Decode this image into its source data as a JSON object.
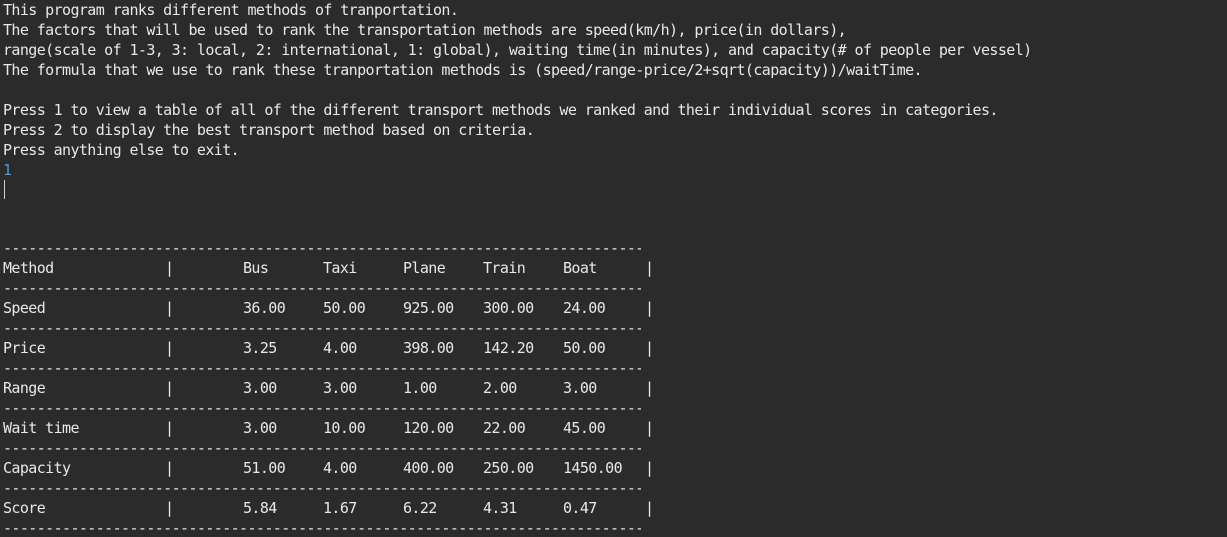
{
  "intro": {
    "line1": "This program ranks different methods of tranportation.",
    "line2": "The factors that will be used to rank the transportation methods are speed(km/h), price(in dollars),",
    "line3": "range(scale of 1-3, 3: local, 2: international, 1: global), waiting time(in minutes), and capacity(# of people per vessel)",
    "line4": "The formula that we use to rank these tranportation methods is (speed/range-price/2+sqrt(capacity))/waitTime."
  },
  "menu": {
    "option1": "Press 1 to view a table of all of the different transport methods we ranked and their individual scores in categories.",
    "option2": "Press 2 to display the best transport method based on criteria.",
    "option3": "Press anything else to exit."
  },
  "user_input": "1",
  "separator_char": "|",
  "table": {
    "header": {
      "label": "Method",
      "cols": [
        "Bus",
        "Taxi",
        "Plane",
        "Train",
        "Boat"
      ]
    },
    "rows": [
      {
        "label": "Speed",
        "values": [
          "36.00",
          "50.00",
          "925.00",
          "300.00",
          "24.00"
        ]
      },
      {
        "label": "Price",
        "values": [
          "3.25",
          "4.00",
          "398.00",
          "142.20",
          "50.00"
        ]
      },
      {
        "label": "Range",
        "values": [
          "3.00",
          "3.00",
          "1.00",
          "2.00",
          "3.00"
        ]
      },
      {
        "label": "Wait time",
        "values": [
          "3.00",
          "10.00",
          "120.00",
          "22.00",
          "45.00"
        ]
      },
      {
        "label": "Capacity",
        "values": [
          "51.00",
          "4.00",
          "400.00",
          "250.00",
          "1450.00"
        ]
      },
      {
        "label": "Score",
        "values": [
          "5.84",
          "1.67",
          "6.22",
          "4.31",
          "0.47"
        ]
      }
    ]
  },
  "colors": {
    "background": "#2b2b2b",
    "text": "#e8e8e8",
    "input_echo": "#4e9ad6"
  }
}
